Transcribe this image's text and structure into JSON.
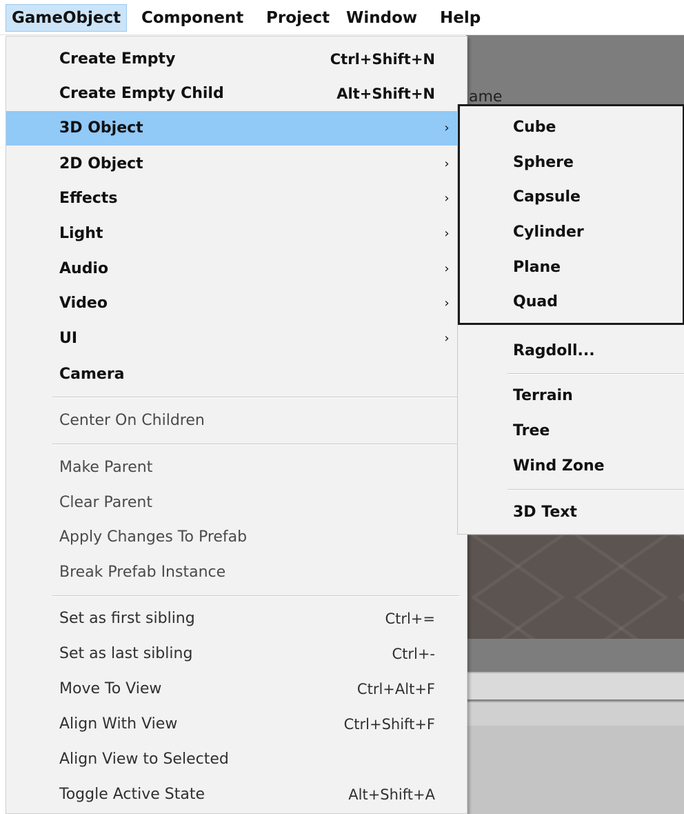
{
  "menubar": {
    "items": [
      {
        "label": "GameObject",
        "active": true
      },
      {
        "label": "Component"
      },
      {
        "label": "Project"
      },
      {
        "label": "Window"
      },
      {
        "label": "Help"
      }
    ]
  },
  "background": {
    "fragment_text": "ame"
  },
  "gameobject_menu": {
    "items": [
      {
        "label": "Create Empty",
        "shortcut": "Ctrl+Shift+N"
      },
      {
        "label": "Create Empty Child",
        "shortcut": "Alt+Shift+N"
      },
      {
        "label": "3D Object",
        "submenu": true,
        "highlighted": true
      },
      {
        "label": "2D Object",
        "submenu": true
      },
      {
        "label": "Effects",
        "submenu": true
      },
      {
        "label": "Light",
        "submenu": true
      },
      {
        "label": "Audio",
        "submenu": true
      },
      {
        "label": "Video",
        "submenu": true
      },
      {
        "label": "UI",
        "submenu": true
      },
      {
        "label": "Camera"
      },
      {
        "label": "Center On Children",
        "disabled": true
      },
      {
        "label": "Make Parent",
        "disabled": true
      },
      {
        "label": "Clear Parent",
        "disabled": true
      },
      {
        "label": "Apply Changes To Prefab",
        "disabled": true
      },
      {
        "label": "Break Prefab Instance",
        "disabled": true
      },
      {
        "label": "Set as first sibling",
        "shortcut": "Ctrl+="
      },
      {
        "label": "Set as last sibling",
        "shortcut": "Ctrl+-"
      },
      {
        "label": "Move To View",
        "shortcut": "Ctrl+Alt+F"
      },
      {
        "label": "Align With View",
        "shortcut": "Ctrl+Shift+F"
      },
      {
        "label": "Align View to Selected"
      },
      {
        "label": "Toggle Active State",
        "shortcut": "Alt+Shift+A"
      }
    ],
    "arrow_glyph": "›"
  },
  "submenu_3d_object": {
    "items": [
      {
        "label": "Cube"
      },
      {
        "label": "Sphere"
      },
      {
        "label": "Capsule"
      },
      {
        "label": "Cylinder"
      },
      {
        "label": "Plane"
      },
      {
        "label": "Quad"
      },
      {
        "label": "Ragdoll..."
      },
      {
        "label": "Terrain"
      },
      {
        "label": "Tree"
      },
      {
        "label": "Wind Zone"
      },
      {
        "label": "3D Text"
      }
    ]
  },
  "colors": {
    "menu_bg": "#f2f2f2",
    "highlight": "#91c9f7",
    "menubar_active": "#cce4f7",
    "scene_gray": "#7d7d7d"
  }
}
